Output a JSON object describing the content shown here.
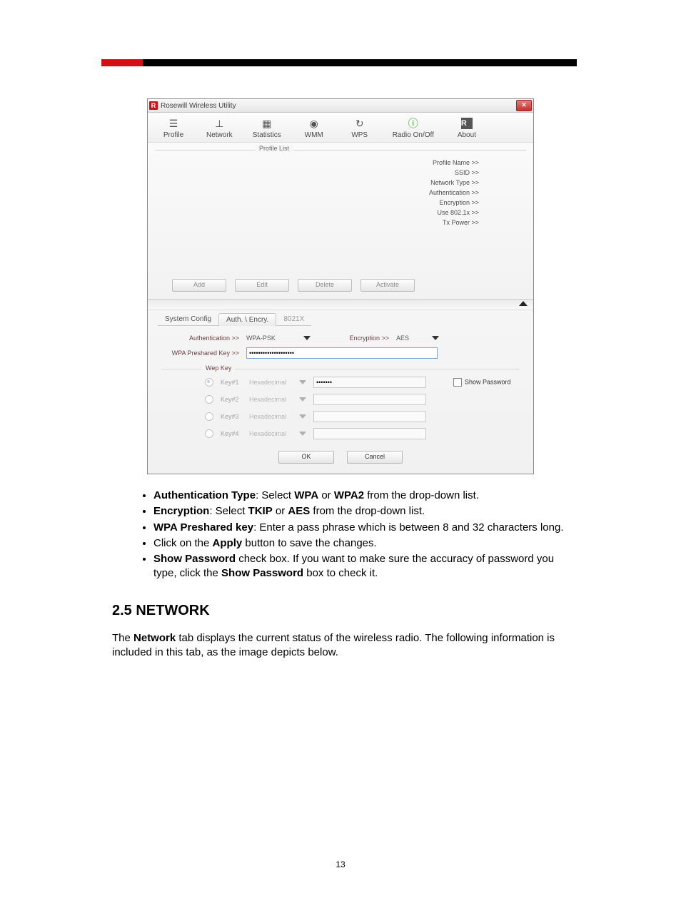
{
  "window": {
    "title": "Rosewill Wireless Utility",
    "toolbar": {
      "profile": "Profile",
      "network": "Network",
      "statistics": "Statistics",
      "wmm": "WMM",
      "wps": "WPS",
      "radio": "Radio On/Off",
      "about": "About"
    },
    "profile_legend": "Profile List",
    "info": {
      "profile_name": "Profile Name >>",
      "ssid": "SSID >>",
      "network_type": "Network Type >>",
      "authentication": "Authentication >>",
      "encryption": "Encryption >>",
      "use8021x": "Use 802.1x >>",
      "tx_power": "Tx Power >>"
    },
    "buttons": {
      "add": "Add",
      "edit": "Edit",
      "delete": "Delete",
      "activate": "Activate",
      "ok": "OK",
      "cancel": "Cancel"
    },
    "subtabs": {
      "system": "System Config",
      "auth": "Auth. \\ Encry.",
      "x8021": "8021X"
    },
    "form": {
      "auth_label": "Authentication >>",
      "auth_value": "WPA-PSK",
      "enc_label": "Encryption >>",
      "enc_value": "AES",
      "psk_label": "WPA Preshared Key >>",
      "psk_value": "••••••••••••••••••••"
    },
    "wep": {
      "legend": "Wep Key",
      "k1": "Key#1",
      "k2": "Key#2",
      "k3": "Key#3",
      "k4": "Key#4",
      "hex": "Hexadecimal",
      "k1_value": "•••••••",
      "show_pw": "Show Password"
    }
  },
  "prose": {
    "b1_a": "Authentication Type",
    "b1_b": ": Select ",
    "b1_c": "WPA",
    "b1_d": " or ",
    "b1_e": "WPA2",
    "b1_f": " from the drop-down list.",
    "b2_a": "Encryption",
    "b2_b": ": Select ",
    "b2_c": "TKIP",
    "b2_d": " or ",
    "b2_e": "AES",
    "b2_f": " from the drop-down list.",
    "b3_a": "WPA Preshared key",
    "b3_b": ": Enter a pass phrase which is between 8 and 32 characters long.",
    "b4_a": "Click on the ",
    "b4_b": "Apply",
    "b4_c": " button to save the changes.",
    "b5_a": "Show Password",
    "b5_b": " check box. If you want to make sure the accuracy of password you type, click the ",
    "b5_c": "Show Password",
    "b5_d": " box to check it.",
    "h2": "2.5 NETWORK",
    "p1_a": "The ",
    "p1_b": "Network",
    "p1_c": " tab displays the current status of the wireless radio.  The following information is included in this tab, as the image depicts below."
  },
  "page_number": "13"
}
